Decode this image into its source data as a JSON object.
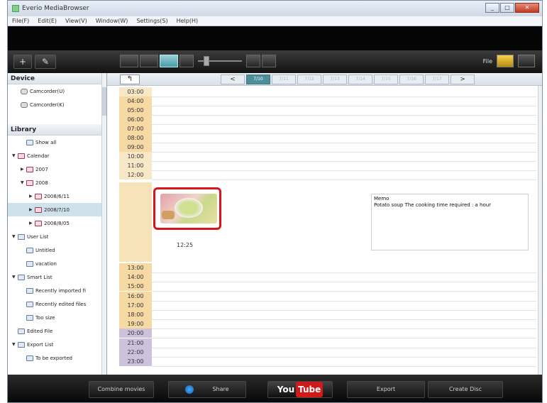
{
  "window": {
    "title": "Everio MediaBrowser",
    "buttons": [
      "_",
      "□",
      "✕"
    ]
  },
  "menu": [
    "File(F)",
    "Edit(E)",
    "View(V)",
    "Window(W)",
    "Settings(S)",
    "Help(H)"
  ],
  "toolbar": {
    "add_label": "+",
    "tools_label": "✎",
    "file_label": "File"
  },
  "sidebar": {
    "device_header": "Device",
    "devices": [
      "Camcorder(U)",
      "Camcorder(K)"
    ],
    "library_header": "Library",
    "items": [
      {
        "label": "Show all",
        "icon": "library-icon",
        "indent": 1,
        "twisty": ""
      },
      {
        "label": "Calendar",
        "icon": "calendar-folder-icon",
        "indent": 0,
        "twisty": "▼"
      },
      {
        "label": "2007",
        "icon": "folder-icon",
        "indent": 1,
        "twisty": "▶"
      },
      {
        "label": "2008",
        "icon": "folder-icon",
        "indent": 1,
        "twisty": "▼"
      },
      {
        "label": "2008/6/11",
        "icon": "folder-icon",
        "indent": 2,
        "twisty": "▶"
      },
      {
        "label": "2008/7/10",
        "icon": "folder-icon",
        "indent": 2,
        "twisty": "▶",
        "selected": true
      },
      {
        "label": "2008/8/05",
        "icon": "folder-icon",
        "indent": 2,
        "twisty": "▶"
      },
      {
        "label": "User List",
        "icon": "user-list-icon",
        "indent": 0,
        "twisty": "▼"
      },
      {
        "label": "Untitled",
        "icon": "list-icon",
        "indent": 1,
        "twisty": ""
      },
      {
        "label": "vacation",
        "icon": "list-icon",
        "indent": 1,
        "twisty": ""
      },
      {
        "label": "Smart List",
        "icon": "smart-list-icon",
        "indent": 0,
        "twisty": "▼"
      },
      {
        "label": "Recently imported fi",
        "icon": "smart-icon",
        "indent": 1,
        "twisty": ""
      },
      {
        "label": "Recently edited files",
        "icon": "smart-icon",
        "indent": 1,
        "twisty": ""
      },
      {
        "label": "Too size",
        "icon": "smart-icon",
        "indent": 1,
        "twisty": ""
      },
      {
        "label": "Edited File",
        "icon": "edited-file-icon",
        "indent": 0,
        "twisty": ""
      },
      {
        "label": "Export List",
        "icon": "export-list-icon",
        "indent": 0,
        "twisty": "▼"
      },
      {
        "label": "To be exported",
        "icon": "export-icon",
        "indent": 1,
        "twisty": ""
      }
    ]
  },
  "nav": {
    "up_label": "↰",
    "prev_label": "<",
    "next_label": ">",
    "day_tabs": [
      {
        "label": "7/10",
        "active": true
      },
      {
        "label": "7/11",
        "active": false
      },
      {
        "label": "7/12",
        "active": false
      },
      {
        "label": "7/13",
        "active": false
      },
      {
        "label": "7/14",
        "active": false
      },
      {
        "label": "7/15",
        "active": false
      },
      {
        "label": "7/16",
        "active": false
      },
      {
        "label": "7/17",
        "active": false
      }
    ]
  },
  "timeline": {
    "hours_top": [
      "03:00",
      "04:00",
      "05:00",
      "06:00",
      "07:00",
      "08:00",
      "09:00",
      "10:00",
      "11:00",
      "12:00"
    ],
    "hours_bottom": [
      "13:00",
      "14:00",
      "15:00",
      "16:00",
      "17:00",
      "18:00",
      "19:00",
      "20:00",
      "21:00",
      "22:00",
      "23:00"
    ],
    "clip_time": "12:25",
    "memo": {
      "title": "Memo",
      "text": "Potato soup   The cooking time required : a hour"
    }
  },
  "bottom": {
    "combine": "Combine movies",
    "share": "Share",
    "youtube_you": "You",
    "youtube_tube": "Tube",
    "export": "Export",
    "create_disc": "Create Disc"
  },
  "colors": {
    "accent": "#d9151c",
    "active_tab": "#4c8f98"
  }
}
